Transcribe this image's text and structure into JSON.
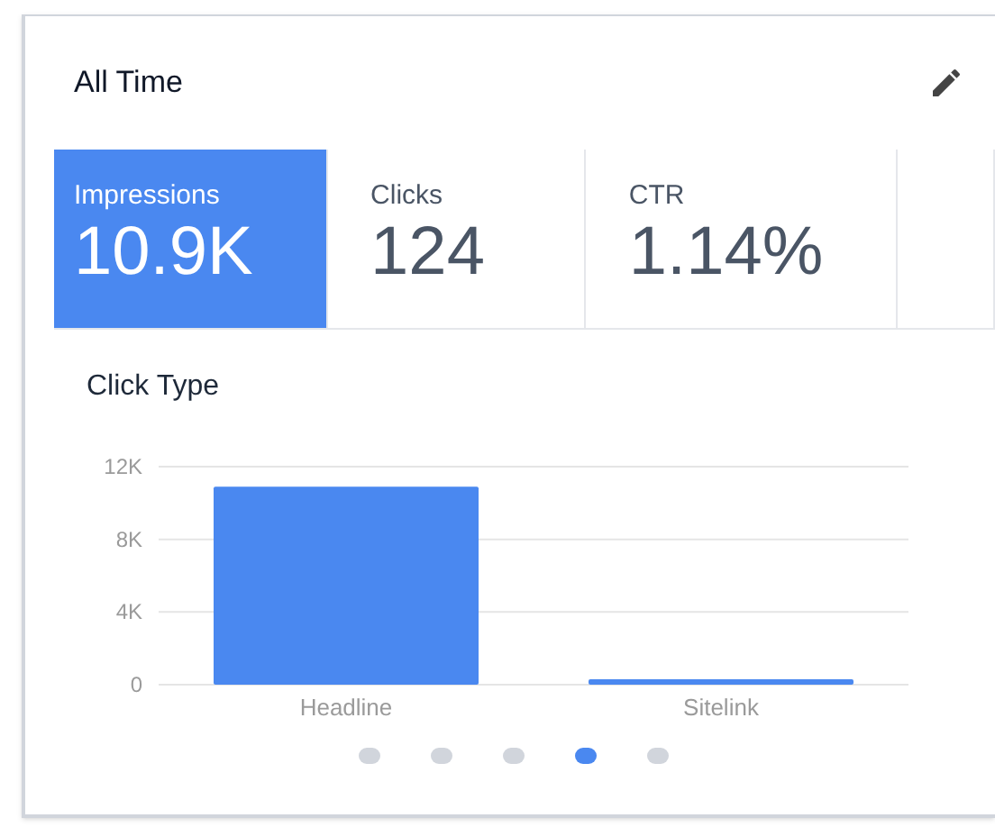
{
  "card": {
    "title": "All Time"
  },
  "metrics": [
    {
      "label": "Impressions",
      "value": "10.9K",
      "selected": true
    },
    {
      "label": "Clicks",
      "value": "124",
      "selected": false
    },
    {
      "label": "CTR",
      "value": "1.14%",
      "selected": false
    }
  ],
  "chart": {
    "title": "Click Type",
    "chart_data": {
      "type": "bar",
      "categories": [
        "Headline",
        "Sitelink"
      ],
      "values": [
        10900,
        300
      ],
      "ylim": [
        0,
        12000
      ],
      "yticks": [
        {
          "value": 0,
          "label": "0"
        },
        {
          "value": 4000,
          "label": "4K"
        },
        {
          "value": 8000,
          "label": "8K"
        },
        {
          "value": 12000,
          "label": "12K"
        }
      ]
    }
  },
  "pager": [
    {
      "selected": false
    },
    {
      "selected": false
    },
    {
      "selected": false
    },
    {
      "selected": true
    },
    {
      "selected": false
    }
  ]
}
